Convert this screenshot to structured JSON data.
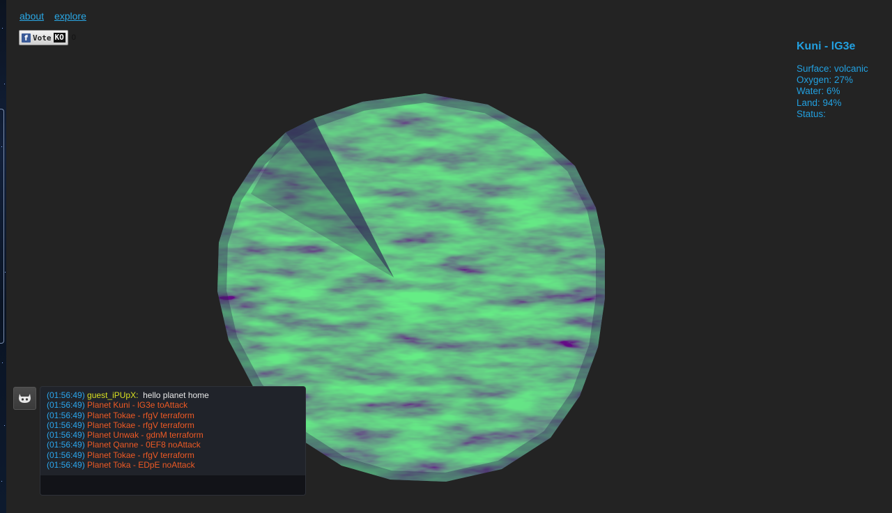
{
  "nav": {
    "about": "about",
    "explore": "explore"
  },
  "vote": {
    "fb_letter": "f",
    "label": "Vote",
    "ko": "KO",
    "count": "0"
  },
  "planet_info": {
    "title": "Kuni - lG3e",
    "surface": "Surface: volcanic",
    "oxygen": "Oxygen: 27%",
    "water": "Water: 6%",
    "land": "Land: 94%",
    "status": "Status:"
  },
  "chat": {
    "messages": [
      {
        "time": "(01:56:49)",
        "user": "guest_iPUpX:",
        "text": "hello planet home"
      },
      {
        "time": "(01:56:49)",
        "event": "Planet Kuni - lG3e toAttack"
      },
      {
        "time": "(01:56:49)",
        "event": "Planet Tokae - rfgV terraform"
      },
      {
        "time": "(01:56:49)",
        "event": "Planet Tokae - rfgV terraform"
      },
      {
        "time": "(01:56:49)",
        "event": "Planet Unwak - gdnM terraform"
      },
      {
        "time": "(01:56:49)",
        "event": "Planet Qanne - 0EF8 noAttack"
      },
      {
        "time": "(01:56:49)",
        "event": "Planet Tokae - rfgV terraform"
      },
      {
        "time": "(01:56:49)",
        "event": "Planet Toka - EDpE noAttack"
      }
    ],
    "input_value": ""
  },
  "icons": {
    "avatar": "github-octocat-icon",
    "facebook": "facebook-icon"
  },
  "colors": {
    "background": "#232323",
    "link": "#2aa8e6",
    "info_text": "#22a0e0",
    "chat_time": "#2ba6ee",
    "chat_user": "#d9e020",
    "chat_event": "#ee5a24",
    "planet_light": "#2f9a4a",
    "planet_dark": "#2a2650"
  }
}
